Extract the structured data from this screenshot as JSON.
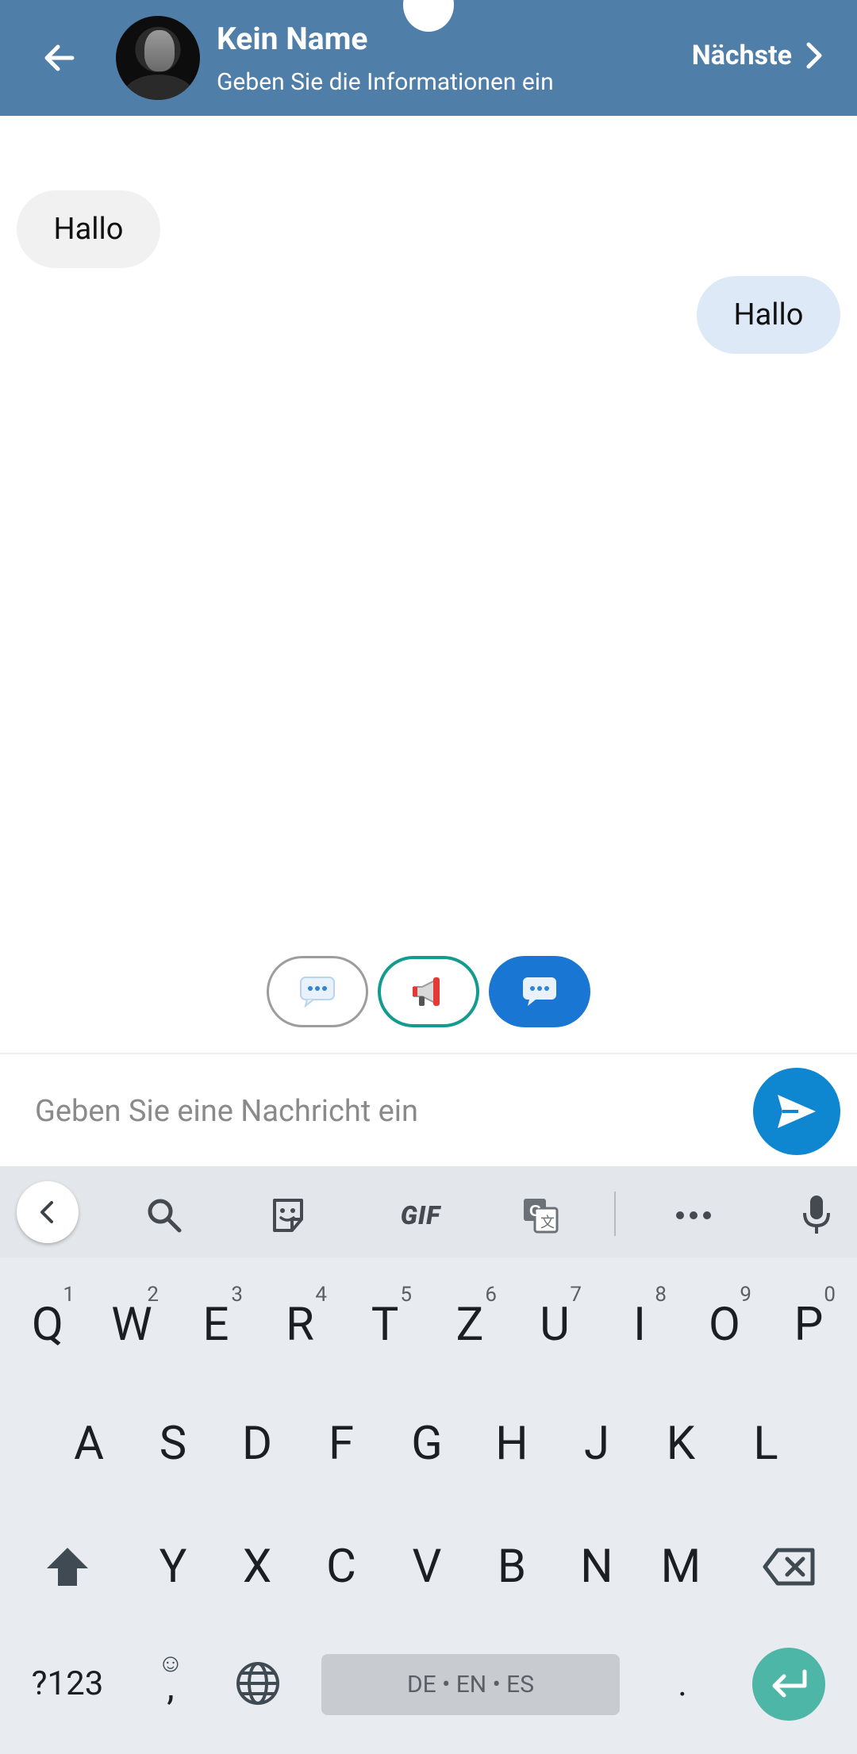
{
  "header": {
    "title": "Kein Name",
    "subtitle": "Geben Sie die Informationen ein",
    "next_label": "Nächste",
    "background": "#4f7ea8"
  },
  "messages": [
    {
      "direction": "incoming",
      "text": "Hallo"
    },
    {
      "direction": "outgoing",
      "text": "Hallo"
    }
  ],
  "mode_buttons": [
    {
      "icon": "speech-bubble-icon",
      "style": "outlined-gray"
    },
    {
      "icon": "megaphone-icon",
      "style": "outlined-teal"
    },
    {
      "icon": "speech-bubble-icon",
      "style": "filled-blue"
    }
  ],
  "composer": {
    "placeholder": "Geben Sie eine Nachricht ein",
    "value": "",
    "send_color": "#0f86d0"
  },
  "keyboard": {
    "toolbar": [
      "collapse-chevron-icon",
      "search-icon",
      "sticker-icon",
      "gif-icon",
      "translate-icon",
      "more-icon",
      "mic-icon"
    ],
    "gif_label": "GIF",
    "row1": [
      {
        "letter": "Q",
        "num": "1"
      },
      {
        "letter": "W",
        "num": "2"
      },
      {
        "letter": "E",
        "num": "3"
      },
      {
        "letter": "R",
        "num": "4"
      },
      {
        "letter": "T",
        "num": "5"
      },
      {
        "letter": "Z",
        "num": "6"
      },
      {
        "letter": "U",
        "num": "7"
      },
      {
        "letter": "I",
        "num": "8"
      },
      {
        "letter": "O",
        "num": "9"
      },
      {
        "letter": "P",
        "num": "0"
      }
    ],
    "row2": [
      "A",
      "S",
      "D",
      "F",
      "G",
      "H",
      "J",
      "K",
      "L"
    ],
    "row3": [
      "Y",
      "X",
      "C",
      "V",
      "B",
      "N",
      "M"
    ],
    "symbols_label": "?123",
    "comma_label": ",",
    "emoji_hint": "☺",
    "space_label": "DE • EN • ES",
    "period_label": ".",
    "enter_color": "#4db6a7"
  }
}
